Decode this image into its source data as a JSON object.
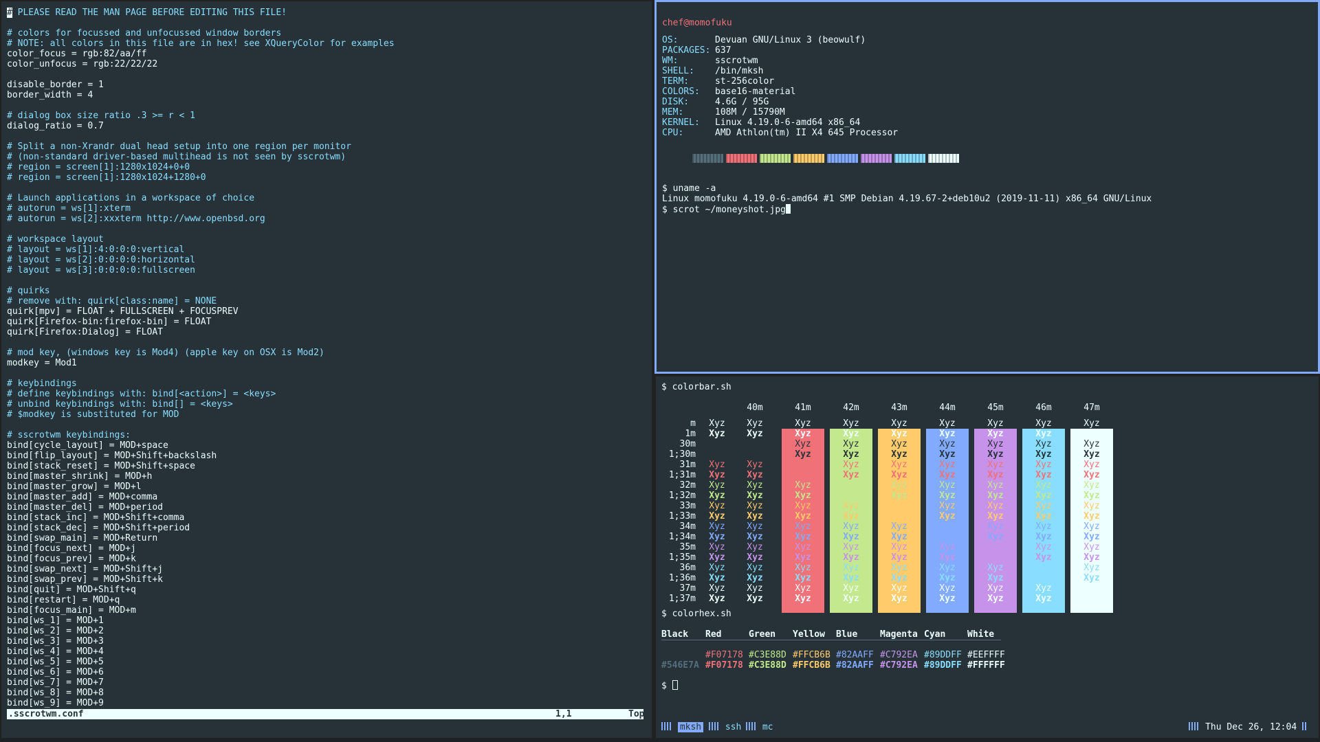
{
  "editor": {
    "lines": [
      {
        "t": "# PLEASE READ THE MAN PAGE BEFORE EDITING THIS FILE!",
        "c": true
      },
      {
        "t": "",
        "c": false
      },
      {
        "t": "# colors for focussed and unfocussed window borders",
        "c": true
      },
      {
        "t": "# NOTE: all colors in this file are in hex! see XQueryColor for examples",
        "c": true
      },
      {
        "t": "color_focus = rgb:82/aa/ff",
        "c": false
      },
      {
        "t": "color_unfocus = rgb:22/22/22",
        "c": false
      },
      {
        "t": "",
        "c": false
      },
      {
        "t": "disable_border = 1",
        "c": false
      },
      {
        "t": "border_width = 4",
        "c": false
      },
      {
        "t": "",
        "c": false
      },
      {
        "t": "# dialog box size ratio .3 >= r < 1",
        "c": true
      },
      {
        "t": "dialog_ratio = 0.7",
        "c": false
      },
      {
        "t": "",
        "c": false
      },
      {
        "t": "# Split a non-Xrandr dual head setup into one region per monitor",
        "c": true
      },
      {
        "t": "# (non-standard driver-based multihead is not seen by sscrotwm)",
        "c": true
      },
      {
        "t": "# region = screen[1]:1280x1024+0+0",
        "c": true
      },
      {
        "t": "# region = screen[1]:1280x1024+1280+0",
        "c": true
      },
      {
        "t": "",
        "c": false
      },
      {
        "t": "# Launch applications in a workspace of choice",
        "c": true
      },
      {
        "t": "# autorun = ws[1]:xterm",
        "c": true
      },
      {
        "t": "# autorun = ws[2]:xxxterm http://www.openbsd.org",
        "c": true
      },
      {
        "t": "",
        "c": false
      },
      {
        "t": "# workspace layout",
        "c": true
      },
      {
        "t": "# layout = ws[1]:4:0:0:0:vertical",
        "c": true
      },
      {
        "t": "# layout = ws[2]:0:0:0:0:horizontal",
        "c": true
      },
      {
        "t": "# layout = ws[3]:0:0:0:0:fullscreen",
        "c": true
      },
      {
        "t": "",
        "c": false
      },
      {
        "t": "# quirks",
        "c": true
      },
      {
        "t": "# remove with: quirk[class:name] = NONE",
        "c": true
      },
      {
        "t": "quirk[mpv] = FLOAT + FULLSCREEN + FOCUSPREV",
        "c": false
      },
      {
        "t": "quirk[Firefox-bin:firefox-bin] = FLOAT",
        "c": false
      },
      {
        "t": "quirk[Firefox:Dialog] = FLOAT",
        "c": false
      },
      {
        "t": "",
        "c": false
      },
      {
        "t": "# mod key, (windows key is Mod4) (apple key on OSX is Mod2)",
        "c": true
      },
      {
        "t": "modkey = Mod1",
        "c": false
      },
      {
        "t": "",
        "c": false
      },
      {
        "t": "# keybindings",
        "c": true
      },
      {
        "t": "# define keybindings with: bind[<action>] = <keys>",
        "c": true
      },
      {
        "t": "# unbind keybindings with: bind[] = <keys>",
        "c": true
      },
      {
        "t": "# $modkey is substituted for MOD",
        "c": true
      },
      {
        "t": "",
        "c": false
      },
      {
        "t": "# sscrotwm keybindings:",
        "c": true
      },
      {
        "t": "bind[cycle_layout] = MOD+space",
        "c": false
      },
      {
        "t": "bind[flip_layout] = MOD+Shift+backslash",
        "c": false
      },
      {
        "t": "bind[stack_reset] = MOD+Shift+space",
        "c": false
      },
      {
        "t": "bind[master_shrink] = MOD+h",
        "c": false
      },
      {
        "t": "bind[master_grow] = MOD+l",
        "c": false
      },
      {
        "t": "bind[master_add] = MOD+comma",
        "c": false
      },
      {
        "t": "bind[master_del] = MOD+period",
        "c": false
      },
      {
        "t": "bind[stack_inc] = MOD+Shift+comma",
        "c": false
      },
      {
        "t": "bind[stack_dec] = MOD+Shift+period",
        "c": false
      },
      {
        "t": "bind[swap_main] = MOD+Return",
        "c": false
      },
      {
        "t": "bind[focus_next] = MOD+j",
        "c": false
      },
      {
        "t": "bind[focus_prev] = MOD+k",
        "c": false
      },
      {
        "t": "bind[swap_next] = MOD+Shift+j",
        "c": false
      },
      {
        "t": "bind[swap_prev] = MOD+Shift+k",
        "c": false
      },
      {
        "t": "bind[quit] = MOD+Shift+q",
        "c": false
      },
      {
        "t": "bind[restart] = MOD+q",
        "c": false
      },
      {
        "t": "bind[focus_main] = MOD+m",
        "c": false
      },
      {
        "t": "bind[ws_1] = MOD+1",
        "c": false
      },
      {
        "t": "bind[ws_2] = MOD+2",
        "c": false
      },
      {
        "t": "bind[ws_3] = MOD+3",
        "c": false
      },
      {
        "t": "bind[ws_4] = MOD+4",
        "c": false
      },
      {
        "t": "bind[ws_5] = MOD+5",
        "c": false
      },
      {
        "t": "bind[ws_6] = MOD+6",
        "c": false
      },
      {
        "t": "bind[ws_7] = MOD+7",
        "c": false
      },
      {
        "t": "bind[ws_8] = MOD+8",
        "c": false
      },
      {
        "t": "bind[ws_9] = MOD+9",
        "c": false
      }
    ],
    "status": {
      "file": ".sscrotwm.conf",
      "position": "1,1",
      "scroll": "Top"
    }
  },
  "sysinfo": {
    "user": "chef@momofuku",
    "fields": [
      {
        "k": "OS:",
        "v": "Devuan GNU/Linux 3 (beowulf)"
      },
      {
        "k": "PACKAGES:",
        "v": "637"
      },
      {
        "k": "WM:",
        "v": "sscrotwm"
      },
      {
        "k": "SHELL:",
        "v": "/bin/mksh"
      },
      {
        "k": "TERM:",
        "v": "st-256color"
      },
      {
        "k": "COLORS:",
        "v": "base16-material"
      },
      {
        "k": "DISK:",
        "v": "4.6G / 95G"
      },
      {
        "k": "MEM:",
        "v": "108M / 15790M"
      },
      {
        "k": "KERNEL:",
        "v": "Linux 4.19.0-6-amd64 x86_64"
      },
      {
        "k": "CPU:",
        "v": "AMD Athlon(tm) II X4 645 Processor"
      }
    ],
    "swatch_colors": [
      "#546e7a",
      "#f07178",
      "#c3e88d",
      "#ffcb6b",
      "#82aaff",
      "#c792ea",
      "#89ddff",
      "#eeffff"
    ],
    "cmd1": "$ uname -a",
    "uname_out": "Linux momofuku 4.19.0-6-amd64 #1 SMP Debian 4.19.67-2+deb10u2 (2019-11-11) x86_64 GNU/Linux",
    "cmd2": "$ scrot ~/moneyshot.jpg"
  },
  "colorbar": {
    "cmd": "$ colorbar.sh",
    "cell_text": "Xyz",
    "col_headers": [
      "",
      "40m",
      "41m",
      "42m",
      "43m",
      "44m",
      "45m",
      "46m",
      "47m"
    ],
    "row_labels": [
      "m",
      "1m",
      "30m",
      "1;30m",
      "31m",
      "1;31m",
      "32m",
      "1;32m",
      "33m",
      "1;33m",
      "34m",
      "1;34m",
      "35m",
      "1;35m",
      "36m",
      "1;36m",
      "37m",
      "1;37m"
    ],
    "bg_colors": [
      "#f07178",
      "#c3e88d",
      "#ffcb6b",
      "#82aaff",
      "#c792ea",
      "#89ddff",
      "#eeffff"
    ],
    "fg_colors": [
      "#eeffff",
      "#eeffff",
      "#263238",
      "#263238",
      "#f07178",
      "#f07178",
      "#c3e88d",
      "#c3e88d",
      "#ffcb6b",
      "#ffcb6b",
      "#82aaff",
      "#82aaff",
      "#c792ea",
      "#c792ea",
      "#89ddff",
      "#89ddff",
      "#eeffff",
      "#eeffff"
    ]
  },
  "colorhex": {
    "cmd": "$ colorhex.sh",
    "headers": [
      "Black",
      "Red",
      "Green",
      "Yellow",
      "Blue",
      "Magenta",
      "Cyan",
      "White"
    ],
    "normal": [
      "",
      "#F07178",
      "#C3E88D",
      "#FFCB6B",
      "#82AAFF",
      "#C792EA",
      "#89DDFF",
      "#EEFFFF"
    ],
    "bright": [
      "#546E7A",
      "#F07178",
      "#C3E88D",
      "#FFCB6B",
      "#82AAFF",
      "#C792EA",
      "#89DDFF",
      "#FFFFFF"
    ],
    "colors": [
      "#546e7a",
      "#f07178",
      "#c3e88d",
      "#ffcb6b",
      "#82aaff",
      "#c792ea",
      "#89ddff",
      "#eeffff"
    ],
    "prompt": "$"
  },
  "tabs": [
    {
      "label": "mksh",
      "active": true
    },
    {
      "label": "ssh",
      "active": false
    },
    {
      "label": "mc",
      "active": false
    }
  ],
  "clock": "Thu Dec 26, 12:04"
}
